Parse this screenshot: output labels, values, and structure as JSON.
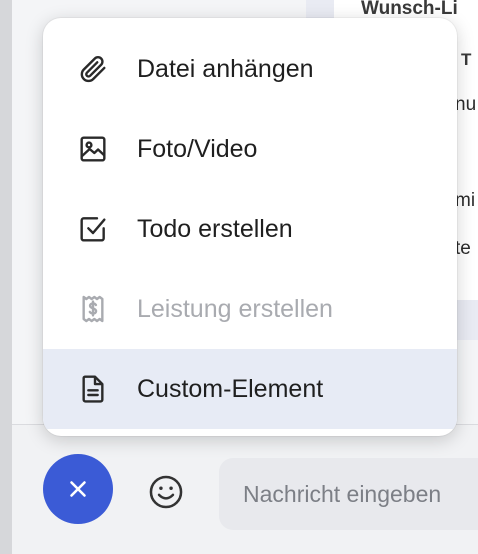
{
  "background": {
    "card_lines": [
      "Wunsch-Li",
      "T",
      "nu",
      "mi",
      "te"
    ]
  },
  "menu": {
    "items": [
      {
        "label": "Datei anhängen",
        "icon": "paperclip-icon",
        "disabled": false,
        "highlighted": false
      },
      {
        "label": "Foto/Video",
        "icon": "image-icon",
        "disabled": false,
        "highlighted": false
      },
      {
        "label": "Todo erstellen",
        "icon": "checkbox-icon",
        "disabled": false,
        "highlighted": false
      },
      {
        "label": "Leistung erstellen",
        "icon": "receipt-dollar-icon",
        "disabled": true,
        "highlighted": false
      },
      {
        "label": "Custom-Element",
        "icon": "document-icon",
        "disabled": false,
        "highlighted": true
      }
    ]
  },
  "composer": {
    "close_icon": "close-icon",
    "emoji_icon": "smiley-icon",
    "input_placeholder": "Nachricht eingeben",
    "input_value": ""
  },
  "colors": {
    "accent": "#3b5bd6",
    "highlight": "#e7ebf5",
    "disabled_text": "#a9abb0"
  }
}
